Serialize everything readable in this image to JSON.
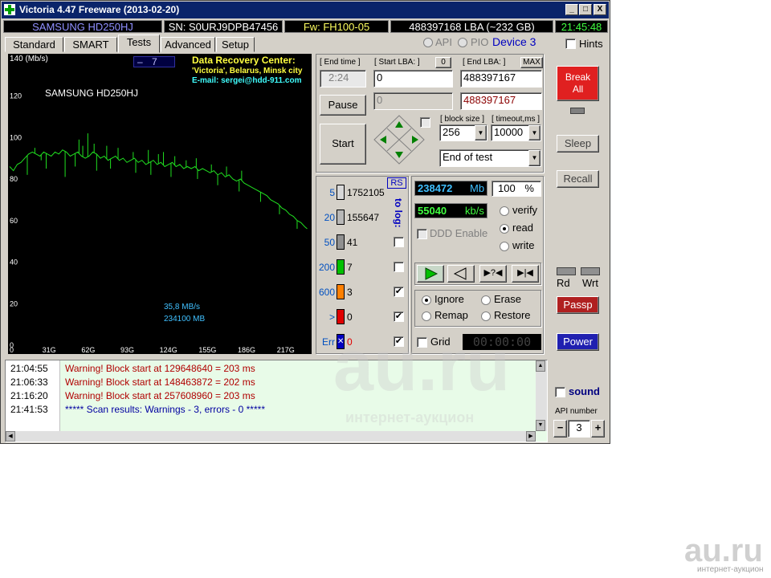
{
  "window": {
    "title": "Victoria 4.47  Freeware (2013-02-20)",
    "min": "_",
    "max": "□",
    "close": "X"
  },
  "info": {
    "model": "SAMSUNG HD250HJ",
    "serial": "SN: S0URJ9DPB47456",
    "firmware": "Fw: FH100-05",
    "lba": "488397168 LBA (~232 GB)",
    "clock": "21:45:48"
  },
  "tabs": [
    "Standard",
    "SMART",
    "Tests",
    "Advanced",
    "Setup"
  ],
  "mode": {
    "api": "API",
    "pio": "PIO",
    "device": "Device 3",
    "hints": "Hints"
  },
  "graph": {
    "ymax_label": "140 (Mb/s)",
    "spin_value": "7",
    "model": "SAMSUNG HD250HJ",
    "drc_title": "Data Recovery Center:",
    "drc_line1": "'Victoria', Belarus, Minsk city",
    "drc_line2": "E-mail: sergei@hdd-911.com",
    "speed": "35,8 MB/s",
    "lba": "234100 MB",
    "y_ticks": [
      "120",
      "100",
      "80",
      "60",
      "40",
      "20",
      "0"
    ],
    "x_ticks": [
      "31G",
      "62G",
      "93G",
      "124G",
      "155G",
      "186G",
      "217G"
    ]
  },
  "controls": {
    "end_time_label": "[ End time ]",
    "end_time": "2:24",
    "start_lba_label": "[ Start LBA: ]",
    "start_lba_reset": "0",
    "start_lba": "0",
    "end_lba_label": "[ End LBA: ]",
    "end_lba_max": "MAX",
    "end_lba": "488397167",
    "pause": "Pause",
    "start": "Start",
    "cur_lba": "0",
    "cur_lba2": "488397167",
    "block_size_label": "[ block size ]",
    "block_size": "256",
    "timeout_label": "[ timeout,ms ]",
    "timeout": "10000",
    "end_action": "End of test"
  },
  "stats": {
    "rs": "RS",
    "to_log": "to log:",
    "rows": [
      {
        "label": "5",
        "count": "1752105",
        "color": "#d8d8d8"
      },
      {
        "label": "20",
        "count": "155647",
        "color": "#b8b8b8"
      },
      {
        "label": "50",
        "count": "41",
        "color": "#909090"
      },
      {
        "label": "200",
        "count": "7",
        "color": "#00c000"
      },
      {
        "label": "600",
        "count": "3",
        "color": "#ff8000"
      },
      {
        "label": ">",
        "count": "0",
        "color": "#e00000"
      },
      {
        "label": "Err",
        "count": "0",
        "color": "#0000c0"
      }
    ],
    "log_checked": [
      false,
      false,
      false,
      false,
      true,
      true,
      true
    ]
  },
  "progress": {
    "mb": "238472",
    "mb_unit": "Mb",
    "percent": "100",
    "percent_unit": "%",
    "speed": "55040",
    "speed_unit": "kb/s",
    "ddd": "DDD Enable",
    "verify": "verify",
    "read": "read",
    "write": "write",
    "ignore": "Ignore",
    "erase": "Erase",
    "remap": "Remap",
    "restore": "Restore",
    "grid": "Grid",
    "timer": "00:00:00"
  },
  "side": {
    "break_all": "Break\nAll",
    "sleep": "Sleep",
    "recall": "Recall",
    "rd": "Rd",
    "wrt": "Wrt",
    "passp": "Passp",
    "power": "Power",
    "sound": "sound",
    "api_number_label": "API number",
    "api_number": "3",
    "minus": "−",
    "plus": "+"
  },
  "log": [
    {
      "time": "21:04:55",
      "msg": "Warning! Block start at 129648640 = 203 ms",
      "color": "#b00000"
    },
    {
      "time": "21:06:33",
      "msg": "Warning! Block start at 148463872 = 202 ms",
      "color": "#b00000"
    },
    {
      "time": "21:16:20",
      "msg": "Warning! Block start at 257608960 = 203 ms",
      "color": "#b00000"
    },
    {
      "time": "21:41:53",
      "msg": "***** Scan results: Warnings - 3, errors - 0 *****",
      "color": "#0000a0"
    }
  ],
  "watermark": {
    "big": "au.ru",
    "small": "интернет-аукцион"
  },
  "curve": [
    [
      0,
      88
    ],
    [
      3,
      86
    ],
    [
      6,
      89
    ],
    [
      9,
      90
    ],
    [
      12,
      92
    ],
    [
      15,
      94
    ],
    [
      18,
      95
    ],
    [
      21,
      94
    ],
    [
      24,
      93
    ],
    [
      27,
      95
    ],
    [
      30,
      94
    ],
    [
      33,
      93
    ],
    [
      36,
      95
    ],
    [
      39,
      94
    ],
    [
      42,
      96
    ],
    [
      45,
      95
    ],
    [
      48,
      93
    ],
    [
      51,
      94
    ],
    [
      54,
      95
    ],
    [
      57,
      93
    ],
    [
      60,
      92
    ],
    [
      63,
      93
    ],
    [
      66,
      95
    ],
    [
      69,
      94
    ],
    [
      72,
      92
    ],
    [
      75,
      93
    ],
    [
      78,
      91
    ],
    [
      81,
      92
    ],
    [
      84,
      93
    ],
    [
      87,
      91
    ],
    [
      90,
      92
    ],
    [
      93,
      90
    ],
    [
      96,
      91
    ],
    [
      99,
      92
    ],
    [
      102,
      90
    ],
    [
      105,
      91
    ],
    [
      108,
      89
    ],
    [
      111,
      90
    ],
    [
      114,
      91
    ],
    [
      117,
      89
    ],
    [
      120,
      90
    ],
    [
      123,
      88
    ],
    [
      126,
      89
    ],
    [
      129,
      90
    ],
    [
      132,
      88
    ],
    [
      135,
      89
    ],
    [
      138,
      87
    ],
    [
      141,
      88
    ],
    [
      144,
      87
    ],
    [
      147,
      88
    ],
    [
      150,
      86
    ],
    [
      153,
      87
    ],
    [
      156,
      86
    ],
    [
      159,
      85
    ],
    [
      162,
      86
    ],
    [
      165,
      84
    ],
    [
      168,
      85
    ],
    [
      171,
      83
    ],
    [
      174,
      84
    ],
    [
      177,
      82
    ],
    [
      180,
      81
    ],
    [
      183,
      82
    ],
    [
      186,
      80
    ],
    [
      189,
      79
    ],
    [
      192,
      78
    ],
    [
      195,
      77
    ],
    [
      198,
      76
    ],
    [
      201,
      75
    ],
    [
      204,
      74
    ],
    [
      207,
      72
    ],
    [
      210,
      71
    ],
    [
      213,
      70
    ],
    [
      216,
      68
    ],
    [
      219,
      67
    ],
    [
      222,
      65
    ],
    [
      225,
      64
    ],
    [
      228,
      62
    ],
    [
      231,
      61
    ],
    [
      234,
      59
    ],
    [
      236,
      58
    ]
  ],
  "spikes": [
    [
      20,
      97
    ],
    [
      25,
      91
    ],
    [
      55,
      101
    ],
    [
      58,
      98
    ],
    [
      62,
      104
    ],
    [
      67,
      99
    ],
    [
      77,
      98
    ],
    [
      86,
      97
    ],
    [
      98,
      95
    ],
    [
      110,
      96
    ],
    [
      118,
      94
    ],
    [
      122,
      95
    ],
    [
      131,
      93
    ],
    [
      140,
      91
    ],
    [
      148,
      92
    ],
    [
      160,
      89
    ],
    [
      172,
      88
    ],
    [
      184,
      86
    ]
  ],
  "dips": [
    [
      14,
      84
    ],
    [
      29,
      87
    ],
    [
      44,
      83
    ],
    [
      52,
      88
    ],
    [
      69,
      86
    ],
    [
      80,
      87
    ],
    [
      100,
      85
    ],
    [
      112,
      84
    ],
    [
      128,
      83
    ],
    [
      149,
      82
    ],
    [
      165,
      79
    ],
    [
      182,
      76
    ],
    [
      199,
      71
    ],
    [
      214,
      65
    ],
    [
      228,
      58
    ]
  ]
}
